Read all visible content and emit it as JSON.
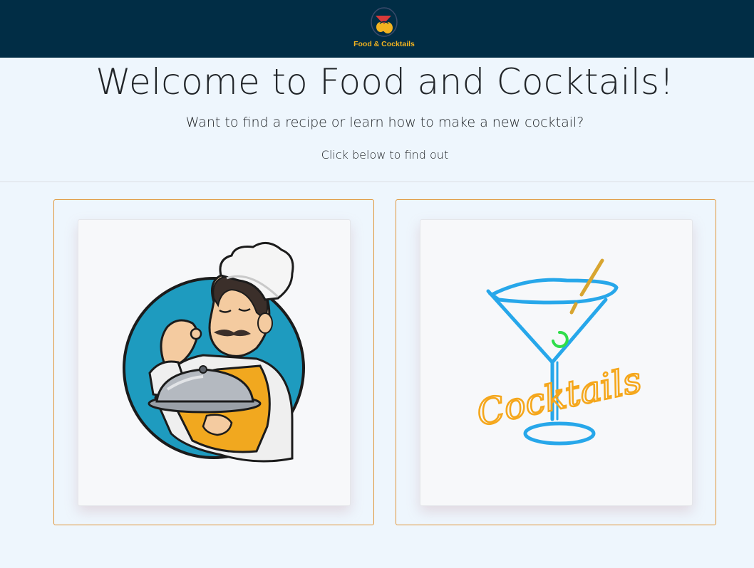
{
  "navbar": {
    "brand_label": "Food & Cocktails",
    "logo_icon": "food-cocktails-logo-icon",
    "background": "#012d45",
    "accent": "#f2b320"
  },
  "hero": {
    "title": "Welcome to Food and Cocktails!",
    "subtitle": "Want to find a recipe or learn how to make a new cocktail?",
    "cta": "Click below to find out"
  },
  "cards": [
    {
      "name": "food",
      "image_icon": "chef-holding-cloche-icon",
      "border_color": "#e0963a"
    },
    {
      "name": "cocktails",
      "image_icon": "neon-cocktail-glass-icon",
      "image_text": "Cocktails",
      "border_color": "#e0963a"
    }
  ]
}
